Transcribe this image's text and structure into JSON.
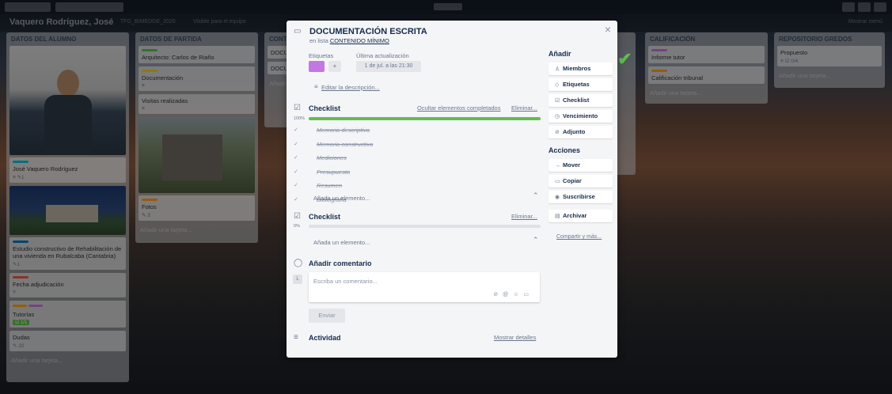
{
  "board": {
    "title": "Vaquero Rodríguez, José",
    "team": "TFG_BIMEDGE_2020",
    "visibility": "Visible para el equipo",
    "menu": "Mostrar menú"
  },
  "lists": [
    {
      "name": "DATOS DEL ALUMNO",
      "cards": [
        {
          "title": "José Vaquero Rodríguez",
          "badge": "1",
          "label_color": "#00c2e0"
        },
        {
          "title": "Estudio constructivo de Rehabilitación de una vivienda en Rubalcaba (Cantabria)",
          "badge": "1",
          "label_color": "#0079bf"
        },
        {
          "title": "Fecha adjudicación",
          "label_color": "#eb5a46"
        },
        {
          "title": "Tutorías",
          "badge": "1/1",
          "label_color": "#ff9f1a"
        },
        {
          "title": "Dudas",
          "badge": "20"
        }
      ],
      "add": "Añadir una tarjeta..."
    },
    {
      "name": "DATOS DE PARTIDA",
      "cards": [
        {
          "title": "Arquitecto: Carlos de Riaño",
          "label_color": "#61bd4f"
        },
        {
          "title": "Documentación",
          "label_color": "#f2d600"
        },
        {
          "title": "Visitas realizadas"
        },
        {
          "title": "Fotos",
          "badge": "3",
          "label_color": "#ff9f1a"
        }
      ],
      "add": "Añadir una tarjeta..."
    },
    {
      "name": "CONTENIDO MÍNIMO",
      "cards": [
        {
          "title": "DOCUMENTACIÓN ESCRITA"
        },
        {
          "title": "DOCUMENTACIÓN GRÁFICA"
        }
      ],
      "add": "Añadir una tarjeta..."
    },
    {
      "name": "CALIFICACIÓN",
      "cards": [
        {
          "title": "Informe tutor",
          "label_color": "#c377e0"
        },
        {
          "title": "Calificación tribunal",
          "label_color": "#ff9f1a"
        }
      ],
      "add": "Añadir una tarjeta..."
    },
    {
      "name": "REPOSITORIO GREDOS",
      "cards": [
        {
          "title": "Propuesto",
          "badge": "0/4"
        }
      ],
      "add": "Añadir una tarjeta..."
    }
  ],
  "modal": {
    "title": "DOCUMENTACIÓN ESCRITA",
    "in_list_prefix": "en lista",
    "list_name": "CONTENIDO MÍNIMO",
    "labels_label": "Etiquetas",
    "label_color": "#c377e0",
    "last_update_label": "Última actualización",
    "last_update": "1 de jul. a las 21:30",
    "add_label": "+",
    "edit_description": "Editar la descripción...",
    "checklist1": {
      "title": "Checklist",
      "hide": "Ocultar elementos completados",
      "delete": "Eliminar...",
      "percent": "100%",
      "progress": 1.0,
      "items": [
        "Memoria descriptiva",
        "Memoria constructiva",
        "Mediciones",
        "Presupuesto",
        "Resumen",
        "Bibliografía"
      ],
      "add_item": "Añada un elemento..."
    },
    "checklist2": {
      "title": "Checklist",
      "delete": "Eliminar...",
      "percent": "0%",
      "progress": 0.0,
      "add_item": "Añada un elemento..."
    },
    "comment": {
      "title": "Añadir comentario",
      "placeholder": "Escriba un comentario...",
      "avatar": "L",
      "send": "Enviar"
    },
    "activity": {
      "title": "Actividad",
      "show_details": "Mostrar detalles"
    },
    "sidebar": {
      "add_title": "Añadir",
      "add_buttons": [
        "Miembros",
        "Etiquetas",
        "Checklist",
        "Vencimiento",
        "Adjunto"
      ],
      "actions_title": "Acciones",
      "action_buttons": [
        "Mover",
        "Copiar",
        "Suscribirse",
        "Archivar"
      ],
      "share": "Compartir y más..."
    }
  }
}
